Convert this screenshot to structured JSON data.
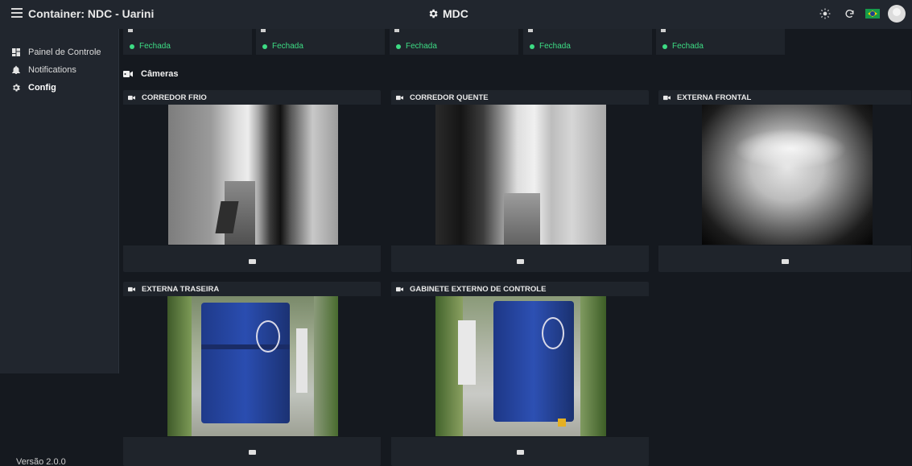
{
  "header": {
    "title": "Container: NDC - Uarini",
    "brand": "MDC"
  },
  "sidebar": {
    "items": [
      {
        "label": "Painel de Controle",
        "icon": "dashboard-icon"
      },
      {
        "label": "Notifications",
        "icon": "notification-icon"
      },
      {
        "label": "Config",
        "icon": "gear-icon"
      }
    ],
    "version": "Versão 2.0.0"
  },
  "status_cards": [
    {
      "status": "Fechada"
    },
    {
      "status": "Fechada"
    },
    {
      "status": "Fechada"
    },
    {
      "status": "Fechada"
    },
    {
      "status": "Fechada"
    }
  ],
  "cameras_section": {
    "title": "Câmeras"
  },
  "cameras": [
    {
      "name": "CORREDOR FRIO"
    },
    {
      "name": "CORREDOR QUENTE"
    },
    {
      "name": "EXTERNA FRONTAL"
    },
    {
      "name": "EXTERNA TRASEIRA"
    },
    {
      "name": "GABINETE EXTERNO DE CONTROLE"
    }
  ],
  "colors": {
    "status_ok": "#3ddc84",
    "panel": "#1f242b",
    "bar": "#21262e",
    "background": "#15191f"
  }
}
